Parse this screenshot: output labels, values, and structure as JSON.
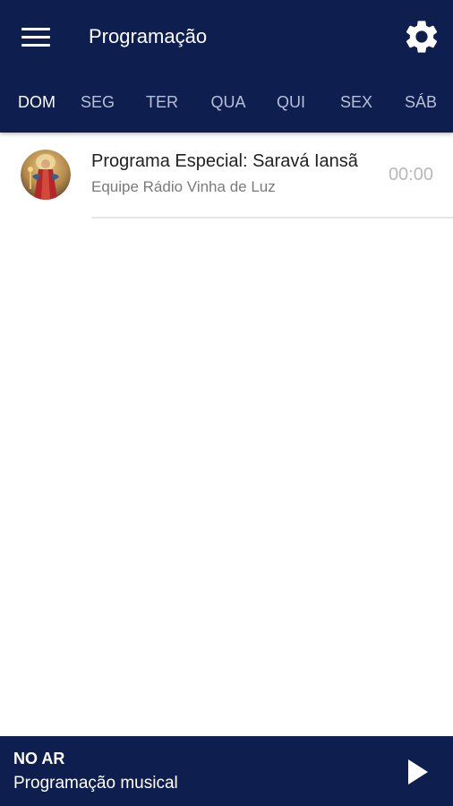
{
  "header": {
    "title": "Programação",
    "menu_icon": "hamburger-menu-icon",
    "settings_icon": "gear-icon",
    "background_color": "#0d1e4f"
  },
  "tabs": [
    {
      "label": "DOM",
      "active": true
    },
    {
      "label": "SEG",
      "active": false
    },
    {
      "label": "TER",
      "active": false
    },
    {
      "label": "QUA",
      "active": false
    },
    {
      "label": "QUI",
      "active": false
    },
    {
      "label": "SEX",
      "active": false
    },
    {
      "label": "SÁB",
      "active": false
    }
  ],
  "schedule": [
    {
      "title": "Programa Especial: Saravá Iansã",
      "host": "Equipe Rádio Vinha de Luz",
      "time": "00:00"
    }
  ],
  "player": {
    "status_label": "NO AR",
    "now_playing": "Programação musical",
    "play_icon": "play-icon"
  }
}
